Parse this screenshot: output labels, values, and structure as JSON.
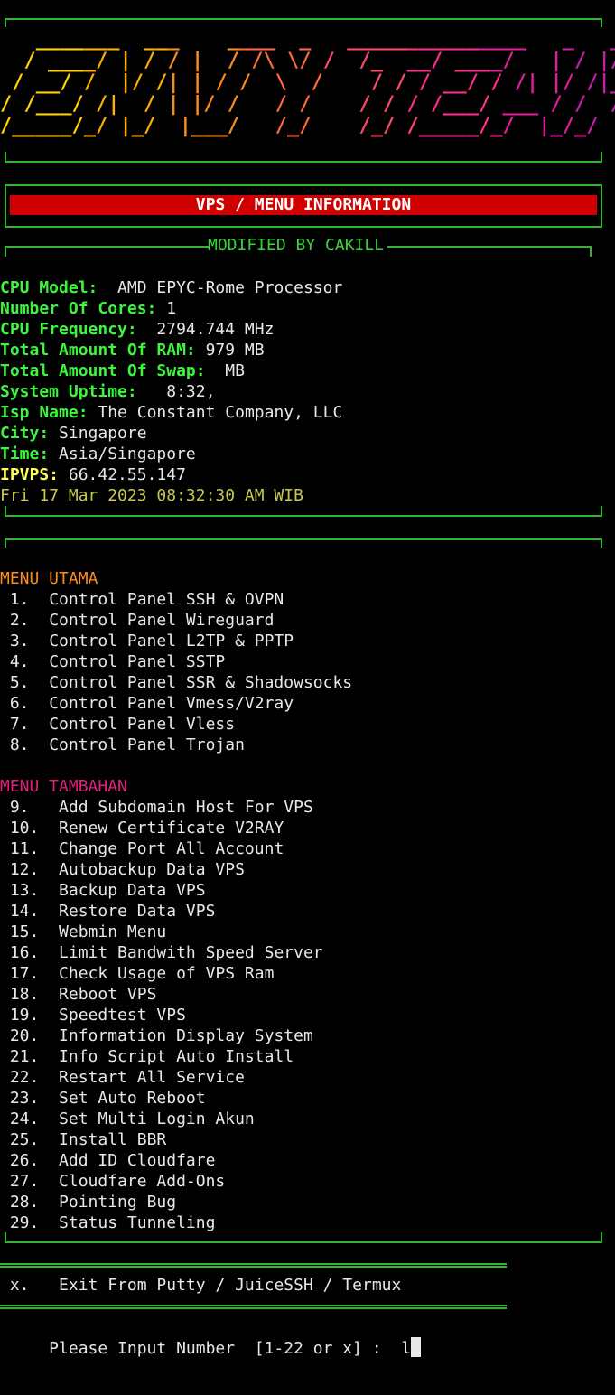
{
  "banner": {
    "lines": [
      "   _______  ___    ____  _   _______________   _   __",
      "  / ____/ | / / |  / /\\ \\/ /  /_  __/ ____/   | / |/ /",
      " / __/ /  |/ /| | / /  \\  /    / / / __/ / /| |/ /|_/ /",
      "/ /___/ /|  / | |/ /   / /    / / / /___/ ___ / /  / /",
      "/_____/_/ |_/  |___/   /_/    /_/ /_____/_/  |_/_/  /_/"
    ]
  },
  "header": {
    "title": "VPS / MENU INFORMATION",
    "modified": "MODIFIED BY CAKILL"
  },
  "info": {
    "cpu_label": "CPU Model:",
    "cpu_value": "  AMD EPYC-Rome Processor",
    "cores_label": "Number Of Cores:",
    "cores_value": " 1",
    "freq_label": "CPU Frequency:",
    "freq_value": "  2794.744 MHz",
    "ram_label": "Total Amount Of RAM:",
    "ram_value": " 979 MB",
    "swap_label": "Total Amount Of Swap:",
    "swap_value": "  MB",
    "uptime_label": "System Uptime:",
    "uptime_value": "   8:32,",
    "isp_label": "Isp Name:",
    "isp_value": " The Constant Company, LLC",
    "city_label": "City:",
    "city_value": " Singapore",
    "time_label": "Time:",
    "time_value": " Asia/Singapore",
    "ip_label": "IPVPS:",
    "ip_value": " 66.42.55.147",
    "datetime": "Fri 17 Mar 2023 08:32:30 AM WIB"
  },
  "menu_utama": {
    "title": "MENU UTAMA",
    "items": [
      {
        "num": " 1.  ",
        "label": "Control Panel SSH & OVPN"
      },
      {
        "num": " 2.  ",
        "label": "Control Panel Wireguard"
      },
      {
        "num": " 3.  ",
        "label": "Control Panel L2TP & PPTP"
      },
      {
        "num": " 4.  ",
        "label": "Control Panel SSTP"
      },
      {
        "num": " 5.  ",
        "label": "Control Panel SSR & Shadowsocks"
      },
      {
        "num": " 6.  ",
        "label": "Control Panel Vmess/V2ray"
      },
      {
        "num": " 7.  ",
        "label": "Control Panel Vless"
      },
      {
        "num": " 8.  ",
        "label": "Control Panel Trojan"
      }
    ]
  },
  "menu_tambahan": {
    "title": "MENU TAMBAHAN",
    "items": [
      {
        "num": " 9.   ",
        "label": "Add Subdomain Host For VPS"
      },
      {
        "num": " 10.  ",
        "label": "Renew Certificate V2RAY"
      },
      {
        "num": " 11.  ",
        "label": "Change Port All Account"
      },
      {
        "num": " 12.  ",
        "label": "Autobackup Data VPS"
      },
      {
        "num": " 13.  ",
        "label": "Backup Data VPS"
      },
      {
        "num": " 14.  ",
        "label": "Restore Data VPS"
      },
      {
        "num": " 15.  ",
        "label": "Webmin Menu"
      },
      {
        "num": " 16.  ",
        "label": "Limit Bandwith Speed Server"
      },
      {
        "num": " 17.  ",
        "label": "Check Usage of VPS Ram"
      },
      {
        "num": " 18.  ",
        "label": "Reboot VPS"
      },
      {
        "num": " 19.  ",
        "label": "Speedtest VPS"
      },
      {
        "num": " 20.  ",
        "label": "Information Display System"
      },
      {
        "num": " 21.  ",
        "label": "Info Script Auto Install"
      },
      {
        "num": " 22.  ",
        "label": "Restart All Service"
      },
      {
        "num": " 23.  ",
        "label": "Set Auto Reboot"
      },
      {
        "num": " 24.  ",
        "label": "Set Multi Login Akun"
      },
      {
        "num": " 25.  ",
        "label": "Install BBR"
      },
      {
        "num": " 26.  ",
        "label": "Add ID Cloudfare"
      },
      {
        "num": " 27.  ",
        "label": "Cloudfare Add-Ons"
      },
      {
        "num": " 28.  ",
        "label": "Pointing Bug"
      },
      {
        "num": " 29.  ",
        "label": "Status Tunneling"
      }
    ]
  },
  "exit": {
    "num": " x.   ",
    "label": "Exit From Putty / JuiceSSH / Termux"
  },
  "prompt": {
    "text": "     Please Input Number  [1-22 or x] :  ",
    "input": "l"
  },
  "colors": {
    "frame": "#2fb52f",
    "title_bar": "#d00000"
  }
}
